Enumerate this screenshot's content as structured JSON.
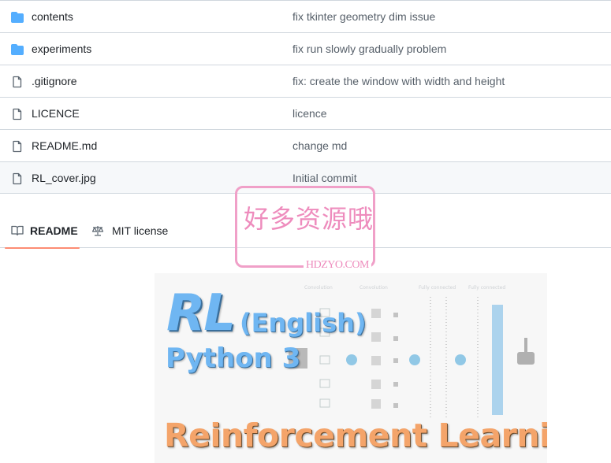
{
  "files": [
    {
      "name": "contents",
      "type": "folder",
      "commit": "fix tkinter geometry dim issue"
    },
    {
      "name": "experiments",
      "type": "folder",
      "commit": "fix run slowly gradually problem"
    },
    {
      "name": ".gitignore",
      "type": "file",
      "commit": "fix: create the window with width and height"
    },
    {
      "name": "LICENCE",
      "type": "file",
      "commit": "licence"
    },
    {
      "name": "README.md",
      "type": "file",
      "commit": "change md"
    },
    {
      "name": "RL_cover.jpg",
      "type": "file",
      "commit": "Initial commit"
    }
  ],
  "readme_tabs": {
    "readme_label": "README",
    "license_label": "MIT license",
    "active": "README"
  },
  "cover_image": {
    "title_main": "RL",
    "title_paren": "(English)",
    "subtitle": "Python 3",
    "bottom_title": "Reinforcement Learning",
    "nn_labels": [
      "Convolution",
      "Convolution",
      "Fully connected",
      "Fully connected"
    ]
  },
  "watermark": {
    "cn_text": "好多资源哦",
    "en_text": "HDZYO.COM"
  },
  "colors": {
    "folder_icon": "#54aeff",
    "tab_underline": "#fd8c73",
    "border": "#d0d7de",
    "cover_blue": "#6fb6f2",
    "cover_orange": "#f4a46a",
    "watermark_pink": "#ee8cbd"
  }
}
